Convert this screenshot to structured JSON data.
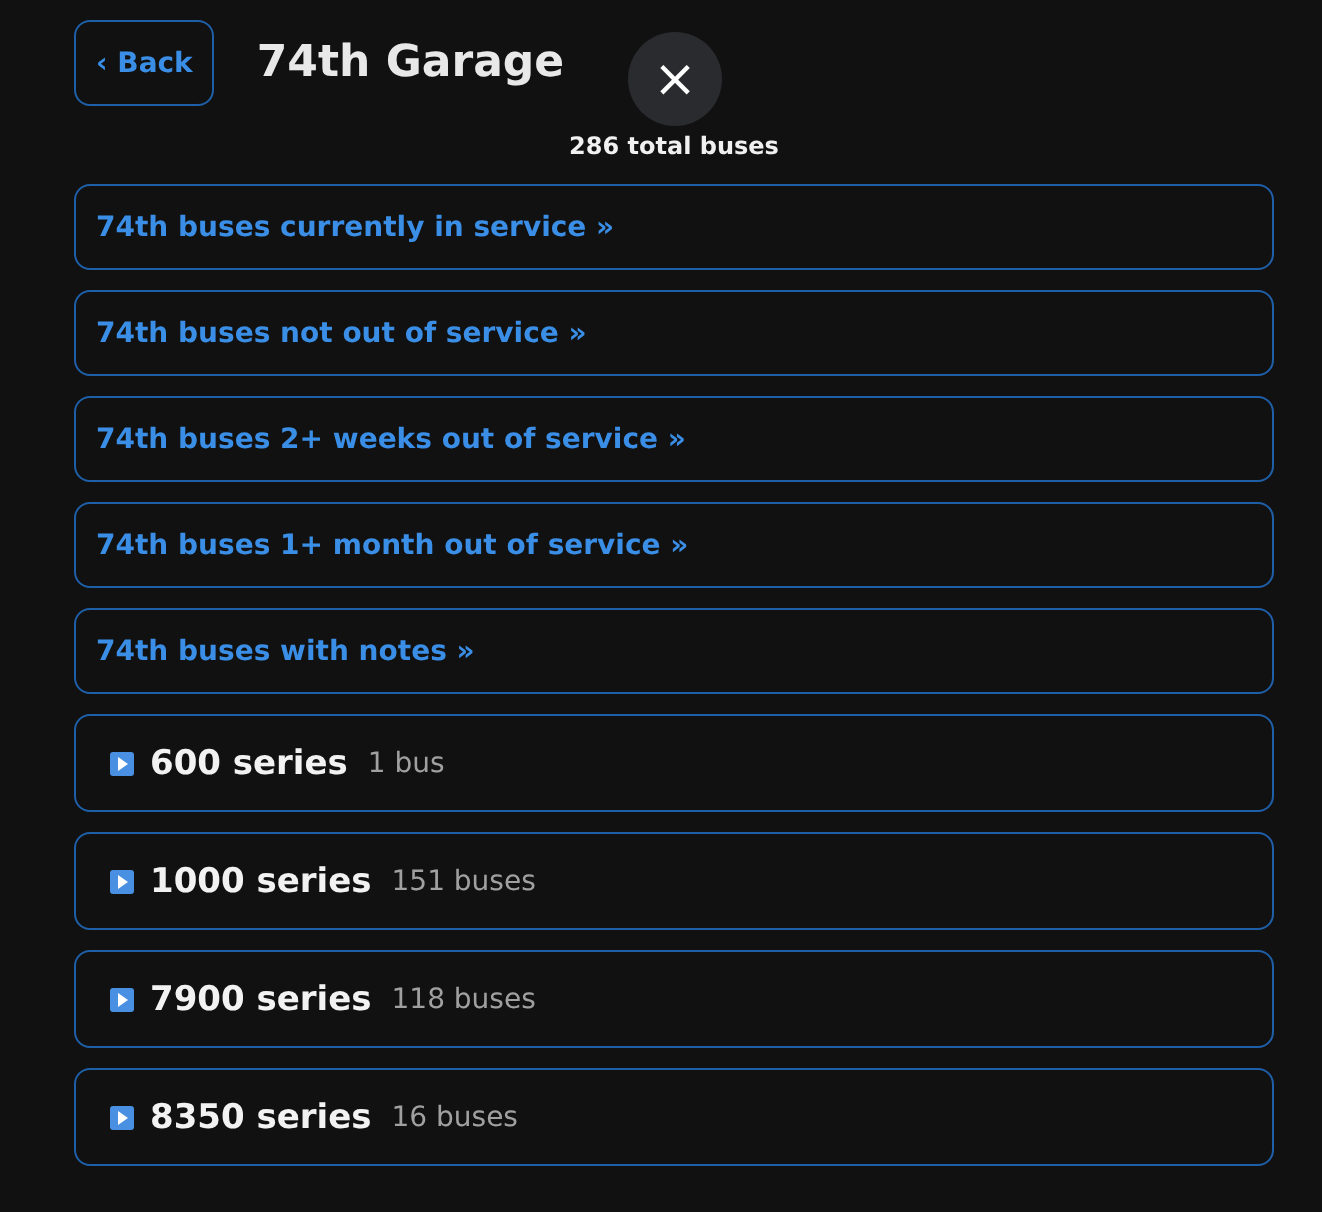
{
  "header": {
    "back": "‹ Back",
    "title": "74th Garage"
  },
  "total": "286 total buses",
  "close_button": {
    "label": "×"
  },
  "links": [
    {
      "label": "74th buses currently in service »"
    },
    {
      "label": "74th buses not out of service »"
    },
    {
      "label": "74th buses 2+ weeks out of service »"
    },
    {
      "label": "74th buses 1+ month out of service »"
    },
    {
      "label": "74th buses with notes »"
    }
  ],
  "series": [
    {
      "name": "600 series",
      "count": "1 bus",
      "expanded": false
    },
    {
      "name": "1000 series",
      "count": "151 buses",
      "expanded": false
    },
    {
      "name": "7900 series",
      "count": "118 buses",
      "expanded": false
    },
    {
      "name": "8350 series",
      "count": "16 buses",
      "expanded": false
    }
  ]
}
